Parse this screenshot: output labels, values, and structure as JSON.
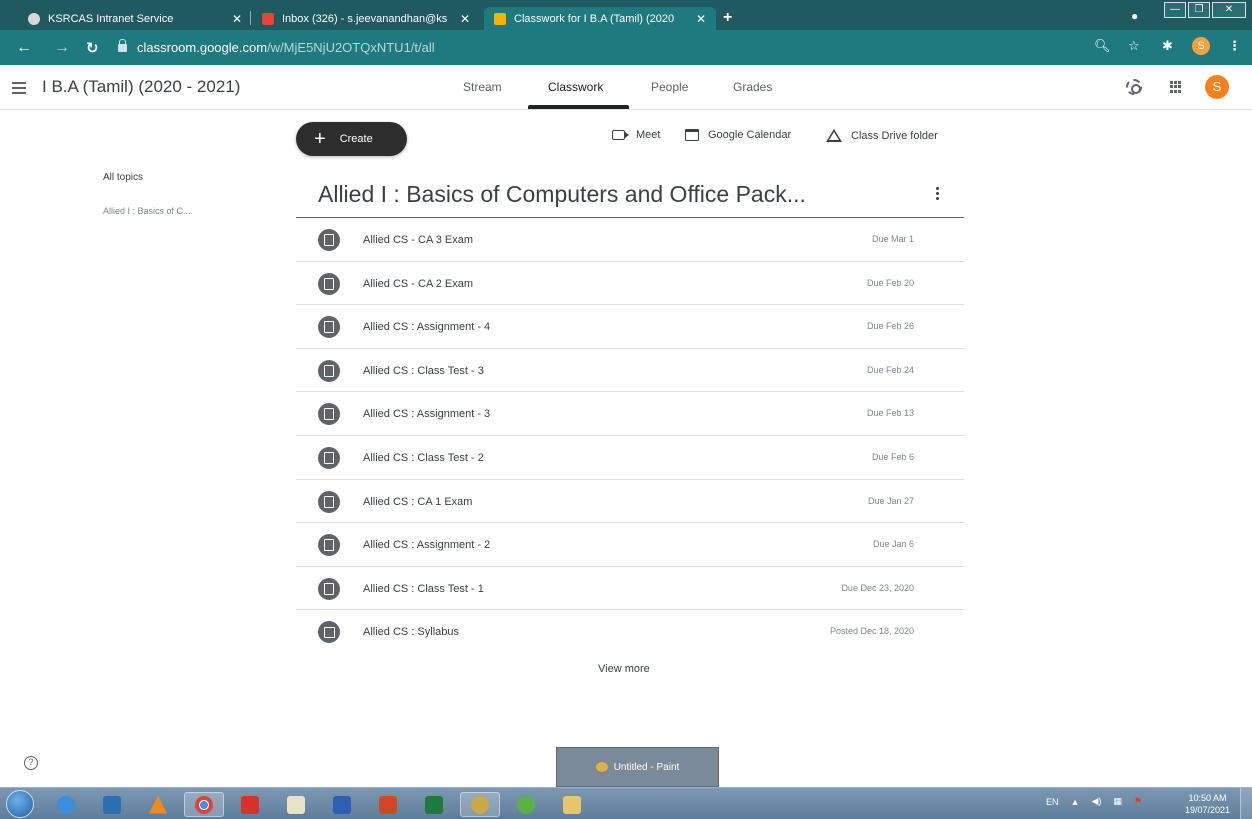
{
  "browser": {
    "tabs": [
      {
        "title": "KSRCAS Intranet Service"
      },
      {
        "title": "Inbox (326) - s.jeevanandhan@ks"
      },
      {
        "title": "Classwork for I B.A (Tamil) (2020"
      }
    ],
    "url_host": "classroom.google.com",
    "url_path": "/w/MjE5NjU2OTQxNTU1/t/all",
    "profile_initial": "S"
  },
  "header": {
    "course_title": "I B.A (Tamil) (2020 - 2021)",
    "tabs": [
      "Stream",
      "Classwork",
      "People",
      "Grades"
    ],
    "account_initial": "S"
  },
  "toolbar": {
    "create_label": "Create",
    "meet_label": "Meet",
    "calendar_label": "Google Calendar",
    "drive_label": "Class Drive folder"
  },
  "sidebar": {
    "all_topics": "All topics",
    "topic": "Allied I : Basics of C..."
  },
  "topic": {
    "title": "Allied I : Basics of Computers and Office Pack..."
  },
  "items": [
    {
      "title": "Allied CS - CA 3 Exam",
      "date": "Due Mar 1",
      "icon": "assignment-icon"
    },
    {
      "title": "Allied CS - CA 2 Exam",
      "date": "Due Feb 20",
      "icon": "assignment-icon"
    },
    {
      "title": "Allied CS : Assignment - 4",
      "date": "Due Feb 26",
      "icon": "assignment-icon"
    },
    {
      "title": "Allied CS : Class Test - 3",
      "date": "Due Feb 24",
      "icon": "assignment-icon"
    },
    {
      "title": "Allied CS : Assignment - 3",
      "date": "Due Feb 13",
      "icon": "assignment-icon"
    },
    {
      "title": "Allied CS : Class Test - 2",
      "date": "Due Feb 6",
      "icon": "assignment-icon"
    },
    {
      "title": "Allied CS : CA 1 Exam",
      "date": "Due Jan 27",
      "icon": "assignment-icon"
    },
    {
      "title": "Allied CS : Assignment - 2",
      "date": "Due Jan 6",
      "icon": "assignment-icon"
    },
    {
      "title": "Allied CS : Class Test - 1",
      "date": "Due Dec 23, 2020",
      "icon": "assignment-icon"
    },
    {
      "title": "Allied CS : Syllabus",
      "date": "Posted Dec 18, 2020",
      "icon": "material-icon"
    }
  ],
  "view_more": "View more",
  "taskbar": {
    "preview_label": "Untitled - Paint",
    "lang": "EN",
    "time": "10:50 AM",
    "date": "19/07/2021"
  }
}
